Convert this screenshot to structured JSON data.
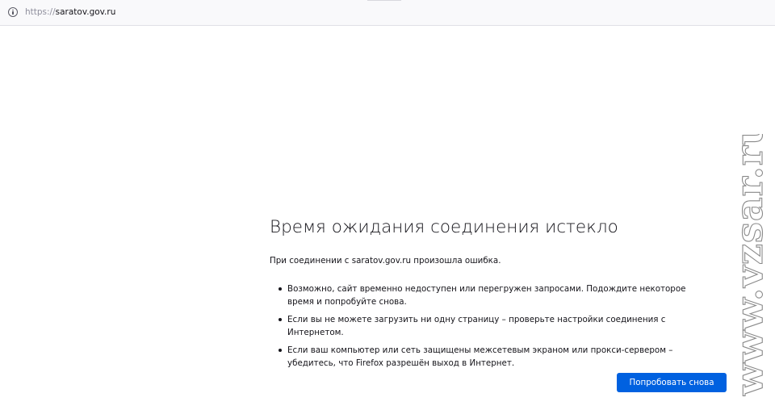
{
  "address_bar": {
    "icon": "info-icon",
    "url_scheme": "https://",
    "url_host": "saratov.gov.ru"
  },
  "error_page": {
    "title": "Время ожидания соединения истекло",
    "description": "При соединении с saratov.gov.ru произошла ошибка.",
    "suggestions": [
      "Возможно, сайт временно недоступен или перегружен запросами. Подождите некоторое время и попробуйте снова.",
      "Если вы не можете загрузить ни одну страницу – проверьте настройки соединения с Интернетом.",
      "Если ваш компьютер или сеть защищены межсетевым экраном или прокси-сервером – убедитесь, что Firefox разрешён выход в Интернет."
    ],
    "try_again_label": "Попробовать снова",
    "button_color": "#0061e0"
  },
  "watermark": {
    "text": "www.vzsar.ru"
  }
}
